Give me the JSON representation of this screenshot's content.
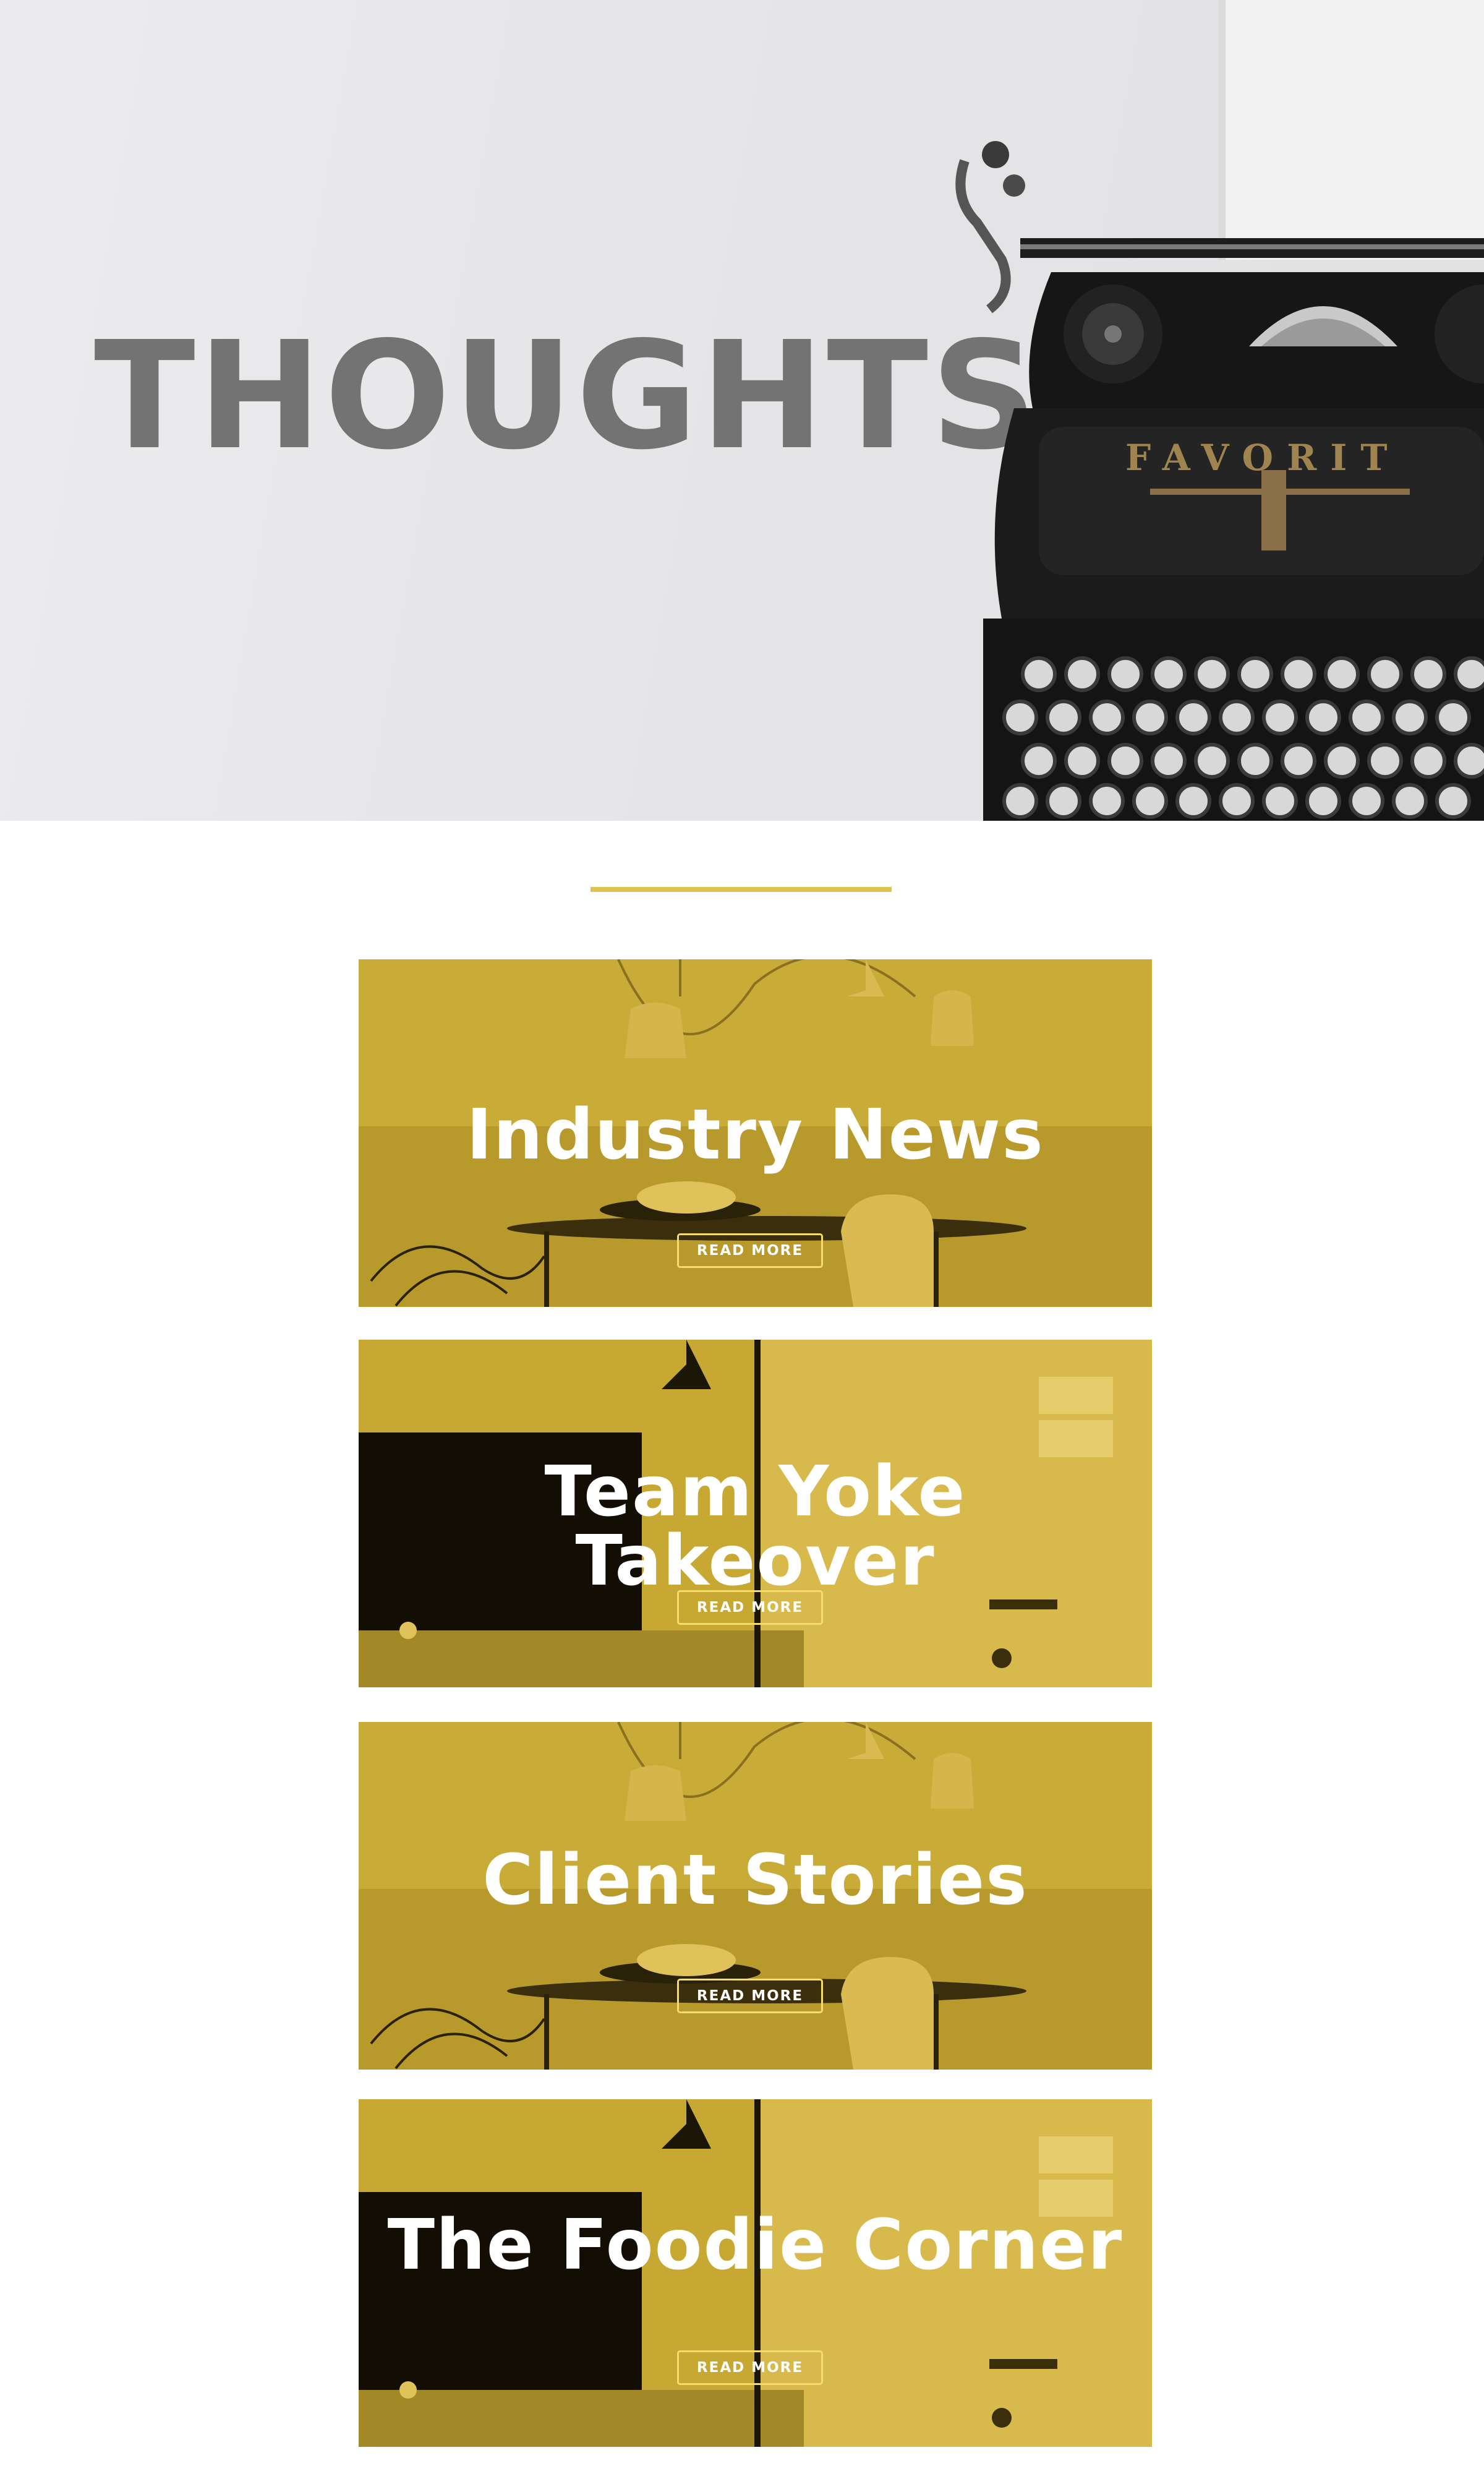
{
  "hero": {
    "title": "THOUGHTS",
    "typewriter_brand": "FAVORIT"
  },
  "cards": [
    {
      "title": "Industry News",
      "button": "READ MORE",
      "scene": "dining"
    },
    {
      "title": "Team Yoke Takeover",
      "button": "READ MORE",
      "scene": "living"
    },
    {
      "title": "Client Stories",
      "button": "READ MORE",
      "scene": "dining"
    },
    {
      "title": "The Foodie Corner",
      "button": "READ MORE",
      "scene": "living"
    }
  ],
  "colors": {
    "accent": "#dfc14d",
    "card_tint": "#c8a936",
    "title_gray": "#737373"
  }
}
